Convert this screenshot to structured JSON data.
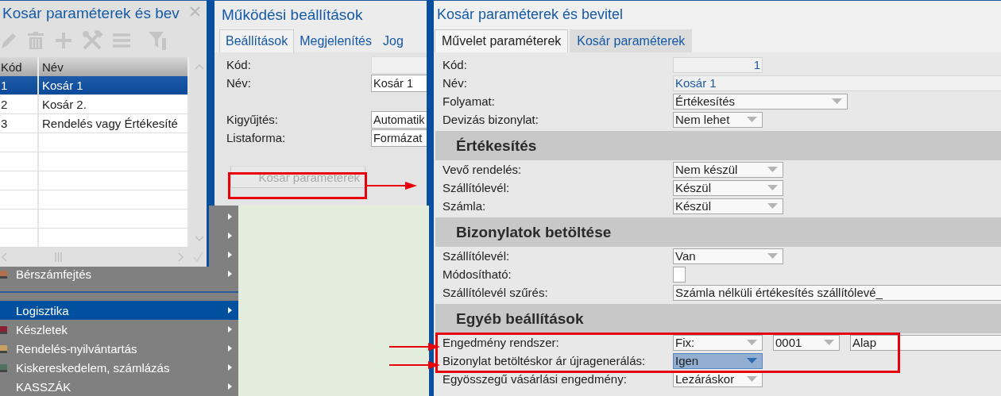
{
  "desktop_menu": {
    "items": [
      {
        "kind": "covered"
      },
      {
        "kind": "covered"
      },
      {
        "kind": "covered"
      },
      {
        "kind": "item",
        "label": "Bérszámfejtés",
        "selected": false,
        "icon": true
      },
      {
        "kind": "separator"
      },
      {
        "kind": "item",
        "label": "Logisztika",
        "selected": true,
        "icon": false
      },
      {
        "kind": "item",
        "label": "Készletek",
        "selected": false,
        "icon": true
      },
      {
        "kind": "item",
        "label": "Rendelés-nyilvántartás",
        "selected": false,
        "icon": true
      },
      {
        "kind": "item",
        "label": "Kiskereskedelem, számlázás",
        "selected": false,
        "icon": true
      },
      {
        "kind": "item",
        "label": "KASSZÁK",
        "selected": false,
        "icon": false
      }
    ]
  },
  "list_window": {
    "title": "Kosár paraméterek és bev",
    "table": {
      "columns": [
        "Kód",
        "Név"
      ],
      "rows": [
        {
          "cells": [
            "1",
            "Kosár 1"
          ],
          "selected": true
        },
        {
          "cells": [
            "2",
            "Kosár 2."
          ],
          "selected": false
        },
        {
          "cells": [
            "3",
            "Rendelés vagy Értékesíté"
          ],
          "selected": false
        }
      ]
    }
  },
  "settings_window": {
    "title": "Működési beállítások",
    "tabs": [
      {
        "label": "Beállítások",
        "selected": true
      },
      {
        "label": "Megjelenítés",
        "selected": false
      },
      {
        "label": "Jog",
        "selected": false
      }
    ],
    "fields": [
      {
        "kind": "field",
        "label": "Kód:",
        "readonly": true
      },
      {
        "kind": "field",
        "label": "Név:",
        "readonly": false,
        "value": "Kosár 1"
      },
      {
        "kind": "spacer"
      },
      {
        "kind": "field",
        "label": "Kigyűjtés:",
        "readonly": false,
        "value": "Automatik"
      },
      {
        "kind": "field",
        "label": "Listaforma:",
        "readonly": false,
        "value": "Formázat"
      }
    ],
    "button": {
      "label": "Kosár paraméterek",
      "disabled": true
    }
  },
  "basket_window": {
    "title": "Kosár paraméterek és bevitel",
    "tabs": [
      {
        "label": "Művelet paraméterek",
        "selected": true
      },
      {
        "label": "Kosár paraméterek",
        "selected": false
      }
    ],
    "fields": [
      {
        "label": "Kód:",
        "controls": [
          {
            "kind": "number",
            "value": "1",
            "readonly": true
          }
        ]
      },
      {
        "label": "Név:",
        "controls": [
          {
            "kind": "text",
            "value": "Kosár 1",
            "readonly": true
          }
        ]
      },
      {
        "label": "Folyamat:",
        "controls": [
          {
            "kind": "dropdown",
            "value": "Értékesítés",
            "focused": false
          }
        ]
      },
      {
        "label": "Devizás bizonylat:",
        "controls": [
          {
            "kind": "dropdown",
            "value": "Nem lehet",
            "focused": false
          }
        ]
      }
    ],
    "sections": [
      {
        "title": "Értékesítés",
        "fields": [
          {
            "label": "Vevő rendelés:",
            "controls": [
              {
                "kind": "dropdown",
                "value": "Nem készül",
                "focused": false
              }
            ]
          },
          {
            "label": "Szállítólevél:",
            "controls": [
              {
                "kind": "dropdown",
                "value": "Készül",
                "focused": false
              }
            ]
          },
          {
            "label": "Számla:",
            "controls": [
              {
                "kind": "dropdown",
                "value": "Készül",
                "focused": false
              }
            ]
          }
        ]
      },
      {
        "title": "Bizonylatok betöltése",
        "fields": [
          {
            "label": "Szállítólevél:",
            "controls": [
              {
                "kind": "dropdown",
                "value": "Van",
                "focused": false
              }
            ]
          },
          {
            "label": "Módosítható:",
            "controls": [
              {
                "kind": "checkbox",
                "checked": false
              }
            ]
          },
          {
            "label": "Szállítólevél szűrés:",
            "controls": [
              {
                "kind": "text",
                "value": "Számla nélküli értékesítés szállítólevé_",
                "readonly": false
              }
            ]
          }
        ]
      },
      {
        "title": "Egyéb beállítások",
        "fields": [
          {
            "label": "Engedmény rendszer:",
            "controls": [
              {
                "kind": "dropdown",
                "value": "Fix:",
                "focused": false
              },
              {
                "kind": "dropdown",
                "value": "0001",
                "focused": false
              },
              {
                "kind": "text",
                "value": "Alap",
                "readonly": false
              }
            ]
          },
          {
            "label": "Bizonylat betöltéskor ár újragenerálás:",
            "controls": [
              {
                "kind": "dropdown",
                "value": "Igen",
                "focused": true
              }
            ]
          },
          {
            "label": "Egyösszegű vásárlási engedmény:",
            "controls": [
              {
                "kind": "dropdown",
                "value": "Lezáráskor",
                "focused": false
              }
            ]
          }
        ]
      }
    ]
  }
}
